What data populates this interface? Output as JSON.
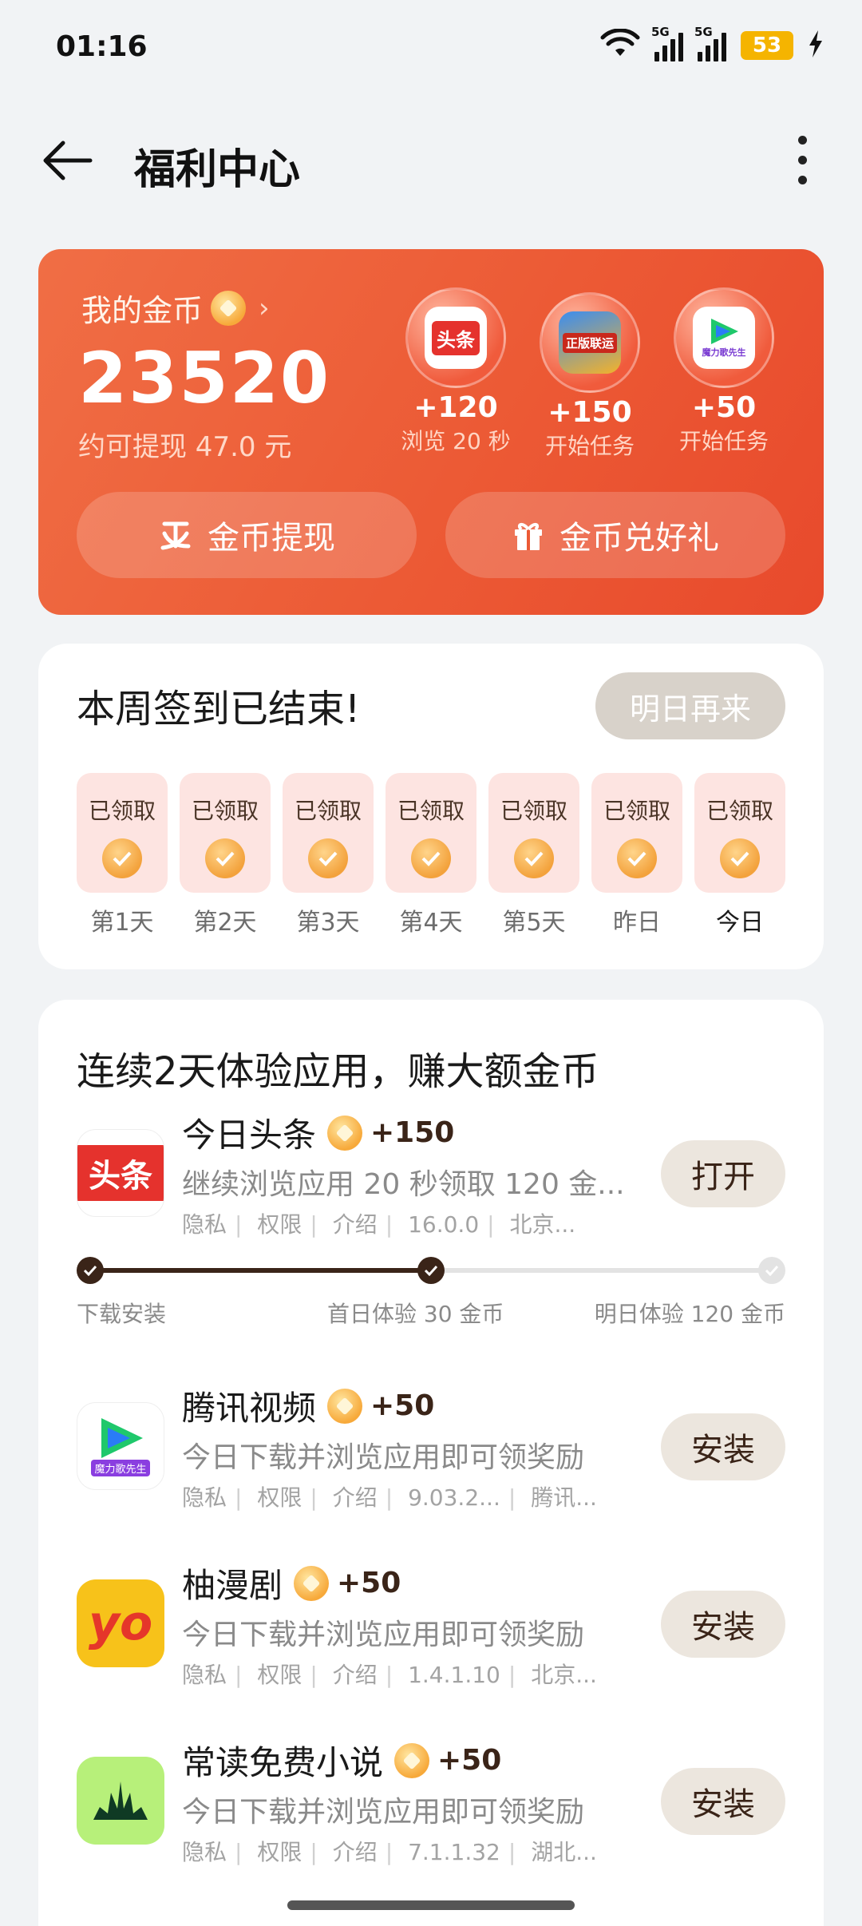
{
  "status_bar": {
    "time": "01:16",
    "network_1": "5G",
    "network_2": "5G",
    "battery": "53"
  },
  "header": {
    "title": "福利中心"
  },
  "coin_card": {
    "label": "我的金币",
    "amount": "23520",
    "cash_hint": "约可提现 47.0 元",
    "promos": [
      {
        "icon_text": "头条",
        "reward": "+120",
        "desc": "浏览 20 秒"
      },
      {
        "icon_text": "正版联运",
        "reward": "+150",
        "desc": "开始任务"
      },
      {
        "icon_text": "魔力歌先生",
        "reward": "+50",
        "desc": "开始任务"
      }
    ],
    "withdraw_label": "金币提现",
    "exchange_label": "金币兑好礼"
  },
  "signin": {
    "title": "本周签到已结束!",
    "button": "明日再来",
    "days": [
      {
        "status": "已领取",
        "label": "第1天"
      },
      {
        "status": "已领取",
        "label": "第2天"
      },
      {
        "status": "已领取",
        "label": "第3天"
      },
      {
        "status": "已领取",
        "label": "第4天"
      },
      {
        "status": "已领取",
        "label": "第5天"
      },
      {
        "status": "已领取",
        "label": "昨日"
      },
      {
        "status": "已领取",
        "label": "今日"
      }
    ]
  },
  "tasks": {
    "title": "连续2天体验应用，赚大额金币",
    "apps": [
      {
        "name": "今日头条",
        "reward": "+150",
        "desc": "继续浏览应用 20 秒领取 120 金...",
        "meta": [
          "隐私",
          "权限",
          "介绍",
          "16.0.0",
          "北京..."
        ],
        "button": "打开",
        "icon_text": "头条"
      },
      {
        "name": "腾讯视频",
        "reward": "+50",
        "desc": "今日下载并浏览应用即可领奖励",
        "meta": [
          "隐私",
          "权限",
          "介绍",
          "9.03.2...",
          "腾讯..."
        ],
        "button": "安装",
        "icon_text": "魔力歌先生"
      },
      {
        "name": "柚漫剧",
        "reward": "+50",
        "desc": "今日下载并浏览应用即可领奖励",
        "meta": [
          "隐私",
          "权限",
          "介绍",
          "1.4.1.10",
          "北京..."
        ],
        "button": "安装",
        "icon_text": "yo"
      },
      {
        "name": "常读免费小说",
        "reward": "+50",
        "desc": "今日下载并浏览应用即可领奖励",
        "meta": [
          "隐私",
          "权限",
          "介绍",
          "7.1.1.32",
          "湖北..."
        ],
        "button": "安装",
        "icon_text": ""
      }
    ],
    "progress": {
      "steps": [
        "下载安装",
        "首日体验 30 金币",
        "明日体验 120 金币"
      ],
      "completed_steps": 2
    }
  },
  "colors": {
    "accent": "#ec5a35",
    "brown": "#3a2418",
    "coin": "#f7a93a"
  }
}
